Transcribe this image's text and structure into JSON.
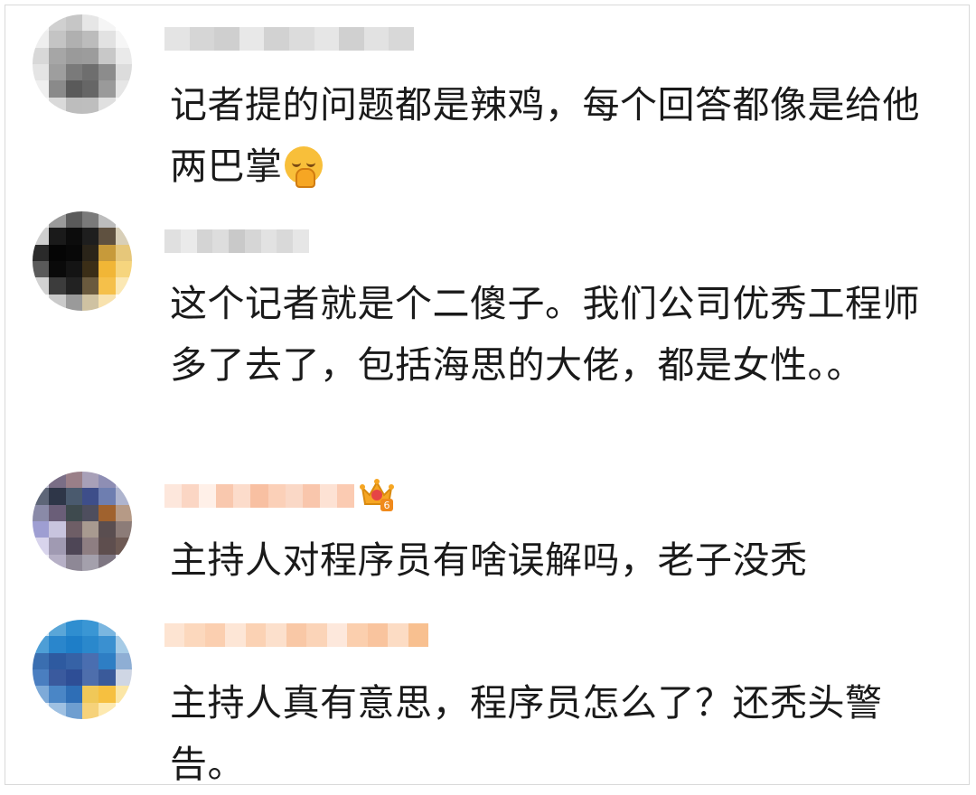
{
  "comments": [
    {
      "text": "记者提的问题都是辣鸡，每个回答都像是给他两巴掌",
      "emoji": "pray-blush-emoji",
      "avatar_colors": [
        "#f4f4f4",
        "#d0d0d0",
        "#c6c6c6",
        "#e6e6e6",
        "#f5f5f5",
        "#ffffff",
        "#eeeeee",
        "#c4c4c4",
        "#b0b0b0",
        "#bcbcbc",
        "#e2e2e2",
        "#f6f6f6",
        "#d8d8d8",
        "#a6a6a6",
        "#9a9a9a",
        "#9c9c9c",
        "#c8c8c8",
        "#eaeaea",
        "#e4e4e4",
        "#9e9e9e",
        "#7a7a7a",
        "#6e6e6e",
        "#8c8c8c",
        "#dcdcdc",
        "#efefef",
        "#8a8a8a",
        "#5a5a5a",
        "#666666",
        "#9a9a9a",
        "#e6e6e6",
        "#f8f8f8",
        "#dadada",
        "#bdbdbd",
        "#bebebe",
        "#e0e0e0",
        "#fafafa"
      ],
      "name_colors": [
        "#e4e4e4",
        "#d6d6d6",
        "#cfcfcf",
        "#e8e8e8",
        "#d2d2d2",
        "#dcdcdc",
        "#e6e6e6",
        "#d0d0d0",
        "#e2e2e2",
        "#d8d8d8"
      ]
    },
    {
      "text": "这个记者就是个二傻子。我们公司优秀工程师多了去了，包括海思的大佬，都是女性。。",
      "avatar_colors": [
        "#f0f0f0",
        "#9a9a9a",
        "#5a5a5a",
        "#7a7a7a",
        "#bdbdbd",
        "#f6f6f6",
        "#cfcfcf",
        "#1a1a1a",
        "#0c0c0c",
        "#1e1e1e",
        "#5f5140",
        "#d8cfb8",
        "#2a2a2a",
        "#050505",
        "#080808",
        "#2a2419",
        "#c79a3a",
        "#e6c77a",
        "#5a5a5a",
        "#0a0a0a",
        "#141414",
        "#3b2e17",
        "#f1b636",
        "#f6d57e",
        "#d2d2d2",
        "#3c3c3c",
        "#222222",
        "#6a5a3e",
        "#f5c04a",
        "#fbe8b4",
        "#fafafa",
        "#cacaca",
        "#9a9a9a",
        "#cfc2a2",
        "#f8e2ae",
        "#ffffff"
      ],
      "name_colors": [
        "#e0e0e0",
        "#eaeaea",
        "#d4d4d4",
        "#dddddd",
        "#c9c9c9",
        "#d6d6d6",
        "#e2e2e2",
        "#d9d9d9",
        "#e6e6e6"
      ]
    },
    {
      "text": "主持人对程序员有啥误解吗，老子没秃",
      "badge": "crown-icon",
      "badge_level": "6",
      "avatar_colors": [
        "#c2c2d4",
        "#7a6e86",
        "#9a7f88",
        "#a8a0b8",
        "#8e8eb4",
        "#c8c8e0",
        "#5e6678",
        "#2e3648",
        "#4a5a6e",
        "#3e4e8a",
        "#6e7eb0",
        "#aeb4ce",
        "#8a8aa8",
        "#6a5e78",
        "#3e4a4e",
        "#4e4e5e",
        "#a0622e",
        "#b69a86",
        "#9e9ed2",
        "#c8c4de",
        "#6e5e66",
        "#a89a90",
        "#5a4e50",
        "#8c7c78",
        "#d8d4ec",
        "#a09ab2",
        "#4e4656",
        "#8e7e82",
        "#5e4e4e",
        "#6e5a54",
        "#f2f0f8",
        "#b6b0c6",
        "#8e8896",
        "#a4a0ac",
        "#7e7682",
        "#e6e4ee"
      ],
      "name_colors": [
        "#fde7dc",
        "#fbd6c4",
        "#fff0e8",
        "#f9c8ae",
        "#fcdccb",
        "#f8c0a2",
        "#fbd0b8",
        "#fad8c6",
        "#f9c6ac",
        "#fde2d4",
        "#fbcbb2"
      ]
    },
    {
      "text": "主持人真有意思，程序员怎么了？还秃头警告。",
      "avatar_colors": [
        "#cfe4f2",
        "#5aa6d8",
        "#2f8ed0",
        "#3a96d4",
        "#7ab6e0",
        "#e6f1f8",
        "#4e9ed6",
        "#2a86cc",
        "#1e7ec8",
        "#2a88cc",
        "#3a90d0",
        "#a6cbe6",
        "#3a6eb0",
        "#2e5aa0",
        "#3662a6",
        "#4a6eb0",
        "#2e7ec4",
        "#8eaed4",
        "#4a7ec0",
        "#3a5a9e",
        "#2e4e96",
        "#4e6eac",
        "#3a5a9a",
        "#cfd6e4",
        "#7eaad8",
        "#4a86c6",
        "#2e6eb6",
        "#f0c858",
        "#f6c040",
        "#fbe6a6",
        "#e2ecf6",
        "#9ec0e2",
        "#6e9ed0",
        "#f6d27a",
        "#fde9b0",
        "#ffffff"
      ],
      "name_colors": [
        "#fde4d2",
        "#fcd8bd",
        "#fbcfb0",
        "#fde6d6",
        "#fbd2b4",
        "#fce0cc",
        "#f9c8a6",
        "#fbd4b8",
        "#fde8dc",
        "#fbcfae",
        "#f9c49e",
        "#fcdcc4",
        "#f8c090"
      ]
    }
  ]
}
